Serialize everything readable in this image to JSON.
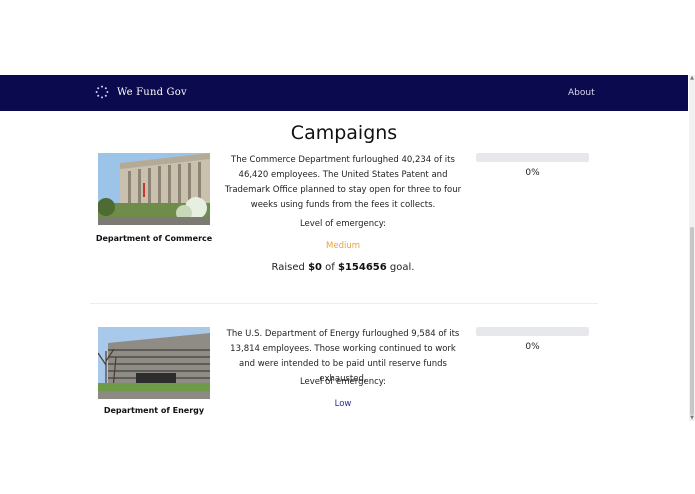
{
  "navbar": {
    "brand": "We Fund Gov",
    "logo_icon": "dotted-ring-icon",
    "about_link": "About",
    "background_color": "#0c0a4e"
  },
  "page": {
    "peek_text": "... ...........  ...... . .",
    "title": "Campaigns"
  },
  "campaigns": [
    {
      "name": "Department of Commerce",
      "description": "The Commerce Department furloughed 40,234 of its 46,420 employees. The United States Patent and Trademark Office planned to stay open for three to four weeks using funds from the fees it collects.",
      "emergency_label": "Level of emergency:",
      "emergency_level": "Medium",
      "emergency_color": "#e8a23a",
      "raised_prefix": "Raised ",
      "raised_amount": "$0",
      "raised_mid": " of ",
      "goal_amount": "$154656",
      "raised_suffix": " goal.",
      "progress_percent": 0,
      "progress_label": "0%"
    },
    {
      "name": "Department of Energy",
      "description": "The U.S. Department of Energy furloughed 9,584 of its 13,814 employees. Those working continued to work and were intended to be paid until reserve funds exhausted.",
      "emergency_label": "Level of emergency:",
      "emergency_level": "Low",
      "emergency_color": "#2a2a9a",
      "progress_percent": 0,
      "progress_label": "0%"
    }
  ]
}
